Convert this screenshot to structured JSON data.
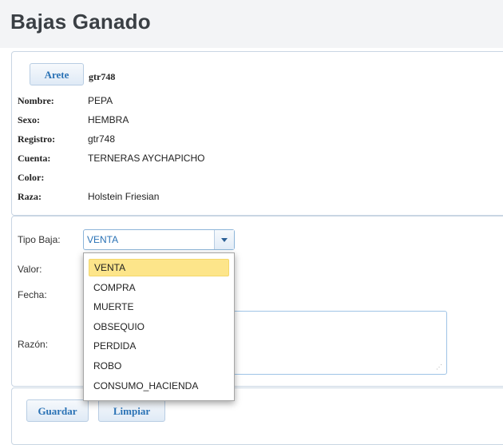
{
  "page": {
    "title": "Bajas Ganado"
  },
  "animal": {
    "arete_button": "Arete",
    "arete_value": "gtr748",
    "fields": [
      {
        "label": "Nombre:",
        "value": "PEPA"
      },
      {
        "label": "Sexo:",
        "value": "HEMBRA"
      },
      {
        "label": "Registro:",
        "value": "gtr748"
      },
      {
        "label": "Cuenta:",
        "value": "TERNERAS AYCHAPICHO"
      },
      {
        "label": "Color:",
        "value": ""
      },
      {
        "label": "Raza:",
        "value": "Holstein Friesian"
      }
    ]
  },
  "form": {
    "tipo_label": "Tipo Baja:",
    "tipo_selected": "VENTA",
    "valor_label": "Valor:",
    "fecha_label": "Fecha:",
    "razon_label": "Razón:",
    "options": [
      "VENTA",
      "COMPRA",
      "MUERTE",
      "OBSEQUIO",
      "PERDIDA",
      "ROBO",
      "CONSUMO_HACIENDA"
    ]
  },
  "actions": {
    "save_label": "Guardar",
    "clear_label": "Limpiar"
  },
  "colors": {
    "accent": "#2a72b5",
    "highlight": "#fde58a",
    "border": "#c9d6e3"
  },
  "icons": {
    "dropdown": "chevron-down-icon",
    "resize": "resize-grip-icon"
  }
}
